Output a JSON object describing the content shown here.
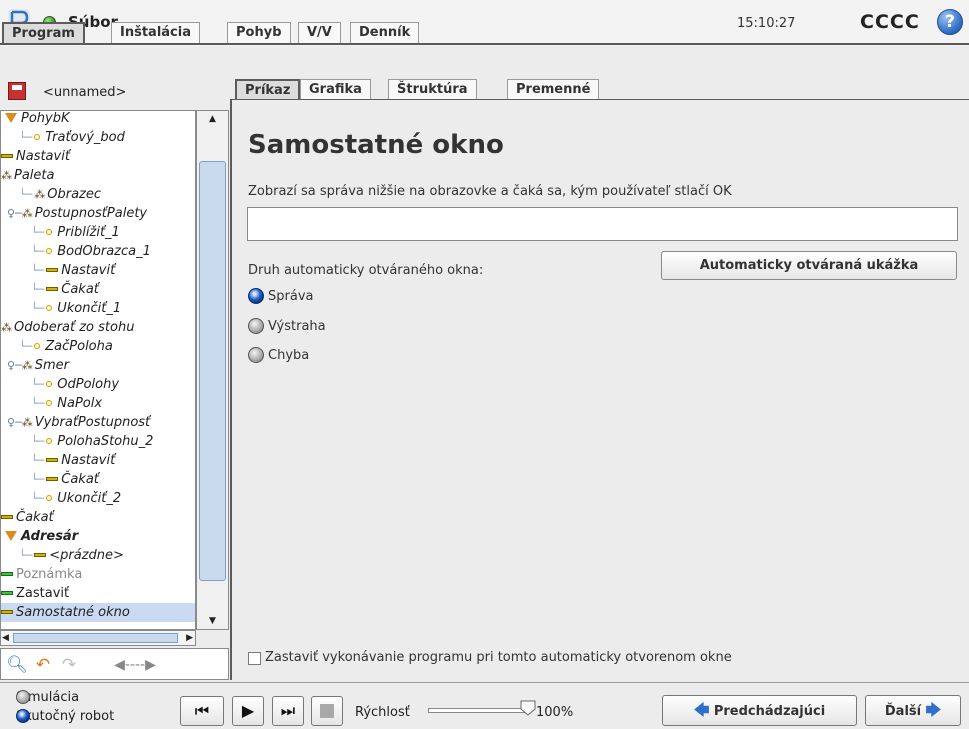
{
  "titlebar": {
    "title": "Súbor",
    "time": "15:10:27",
    "robot_name": "CCCC",
    "help": "?"
  },
  "main_tabs": [
    "Program",
    "Inštalácia",
    "Pohyb",
    "V/V",
    "Denník"
  ],
  "program_name": "<unnamed>",
  "sub_tabs": [
    "Príkaz",
    "Grafika",
    "Štruktúra",
    "Premenné"
  ],
  "tree": [
    {
      "label": "PohybK",
      "icon": "triangle-down"
    },
    {
      "label": "Traťový_bod",
      "icon": "waypoint"
    },
    {
      "label": "Nastaviť",
      "icon": "bar-yellow"
    },
    {
      "label": "Paleta",
      "icon": "pallet"
    },
    {
      "label": "Obrazec",
      "icon": "pallet"
    },
    {
      "label": "PostupnosťPalety",
      "icon": "pallet"
    },
    {
      "label": "Priblížiť_1",
      "icon": "waypoint"
    },
    {
      "label": "BodObrazca_1",
      "icon": "waypoint"
    },
    {
      "label": "Nastaviť",
      "icon": "bar-yellow"
    },
    {
      "label": "Čakať",
      "icon": "bar-yellow"
    },
    {
      "label": "Ukončiť_1",
      "icon": "waypoint"
    },
    {
      "label": "Odoberať zo stohu",
      "icon": "pallet"
    },
    {
      "label": "ZačPoloha",
      "icon": "waypoint"
    },
    {
      "label": "Smer",
      "icon": "pallet"
    },
    {
      "label": "OdPolohy",
      "icon": "waypoint"
    },
    {
      "label": "NaPolx",
      "icon": "waypoint"
    },
    {
      "label": "VybraťPostupnosť",
      "icon": "pallet"
    },
    {
      "label": "PolohaStohu_2",
      "icon": "waypoint"
    },
    {
      "label": "Nastaviť",
      "icon": "bar-yellow"
    },
    {
      "label": "Čakať",
      "icon": "bar-yellow"
    },
    {
      "label": "Ukončiť_2",
      "icon": "waypoint"
    },
    {
      "label": "Čakať",
      "icon": "bar-yellow"
    },
    {
      "label": "Adresár",
      "icon": "triangle-down"
    },
    {
      "label": "<prázdne>",
      "icon": "bar-yellow"
    },
    {
      "label": "Poznámka",
      "icon": "bar-green"
    },
    {
      "label": "Zastaviť",
      "icon": "bar-green"
    },
    {
      "label": "Samostatné okno",
      "icon": "bar-yellow"
    }
  ],
  "main": {
    "title": "Samostatné okno",
    "description": "Zobrazí sa správa nižšie na obrazovke a čaká sa, kým používateľ stlačí OK",
    "message_value": "",
    "preview_button": "Automaticky otváraná ukážka",
    "type_label": "Druh automaticky otváraného okna:",
    "types": [
      {
        "label": "Správa",
        "checked": true
      },
      {
        "label": "Výstraha",
        "checked": false
      },
      {
        "label": "Chyba",
        "checked": false
      }
    ],
    "stop_checkbox_label": "Zastaviť vykonávanie programu pri tomto automaticky otvorenom okne",
    "stop_checked": false
  },
  "footer": {
    "modes": [
      {
        "label": "Simulácia",
        "checked": false
      },
      {
        "label": "Skutočný robot",
        "checked": true
      }
    ],
    "speed_label": "Rýchlosť",
    "speed_value": "100%",
    "speed_fraction": 1.0,
    "prev_button": "Predchádzajúci",
    "next_button": "Ďalší"
  },
  "colors": {
    "accent": "#2f6fc9",
    "selection": "#c9daf2",
    "status_green": "#2e8a1e"
  }
}
